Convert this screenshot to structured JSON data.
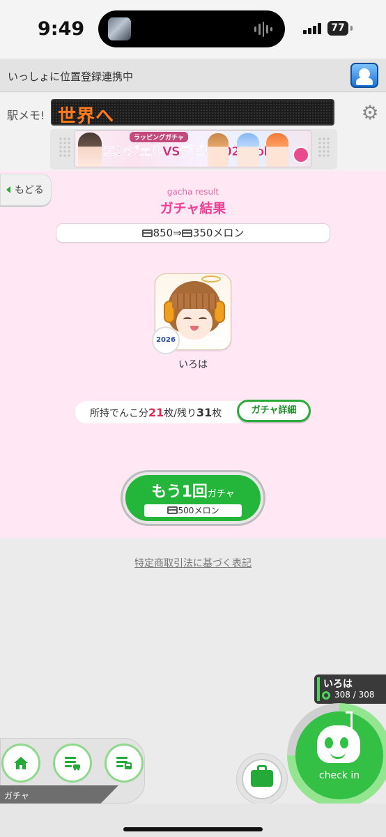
{
  "status_bar": {
    "time": "9:49",
    "battery": "77"
  },
  "location_bar": {
    "text": "いっしょに位置登録連携中"
  },
  "memo": {
    "label": "駅メモ!",
    "ticker": "世界へ"
  },
  "banner": {
    "tag": "ラッピングガチャ",
    "title": "エンジェルVSデビル2026Vol.2"
  },
  "back": {
    "label": "もどる"
  },
  "result": {
    "subtitle": "gacha result",
    "title": "ガチャ結果",
    "cost_before": "850",
    "arrow": "⇒",
    "cost_after": "350",
    "cost_unit": "メロン"
  },
  "character": {
    "name": "いろは",
    "badge": "2026"
  },
  "owned": {
    "prefix": "所持でんこ分",
    "owned_count": "21",
    "middle": "枚/残り",
    "remaining_count": "31",
    "suffix": "枚"
  },
  "detail_button": {
    "label": "ガチャ詳細"
  },
  "again_button": {
    "label_main": "もう1回",
    "label_sub": "ガチャ",
    "price": "500",
    "price_unit": "メロン"
  },
  "law_link": {
    "label": "特定商取引法に基づく表記"
  },
  "char_status": {
    "name": "いろは",
    "hp_current": "308",
    "hp_sep": "/",
    "hp_max": "308",
    "hp_fill": 0.75
  },
  "checkin": {
    "label": "check in"
  },
  "bottom_nav": {
    "items": [
      {
        "icon": "home-icon"
      },
      {
        "icon": "list-car-icon"
      },
      {
        "icon": "list-train-icon"
      }
    ],
    "current_tab": "ガチャ"
  },
  "colors": {
    "accent_green": "#2eaa3a",
    "accent_pink": "#ee3f94",
    "panel_pink": "#ffe8f4"
  }
}
